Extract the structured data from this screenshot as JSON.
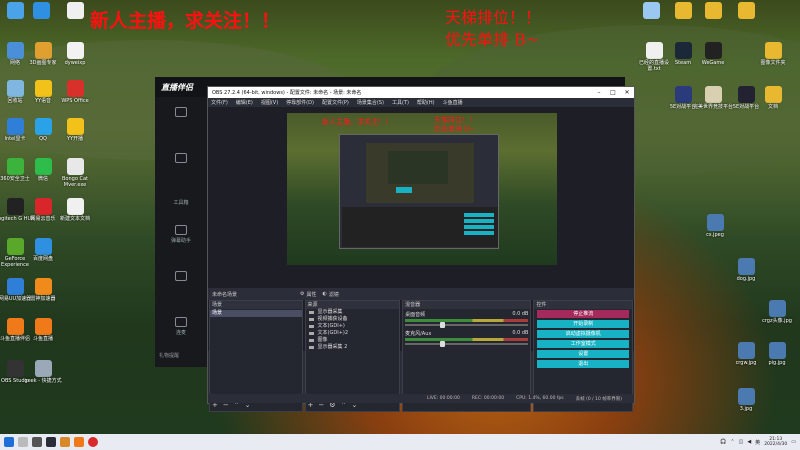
{
  "banners": {
    "line1": "新人主播，求关注！！",
    "line2": "天梯排位！！",
    "line3": "优先单排 B~"
  },
  "desktop_icons_left": [
    {
      "label": "",
      "color": "#4aa3e8"
    },
    {
      "label": "",
      "color": "#2f8fe0"
    },
    {
      "label": "",
      "color": "#f0f0f0"
    },
    {
      "label": "",
      "color": "#2f8fe0"
    },
    {
      "label": "网络",
      "color": "#4a8fd8"
    },
    {
      "label": "3D画图专家",
      "color": "#e0a030"
    },
    {
      "label": "dyweixp",
      "color": "#f2f2f2"
    },
    {
      "label": "回收站",
      "color": "#7fb7e0"
    },
    {
      "label": "YY语音",
      "color": "#f2c21a"
    },
    {
      "label": "WPS Office",
      "color": "#d8302a"
    },
    {
      "label": "Intel显卡",
      "color": "#2f7fd8"
    },
    {
      "label": "QQ",
      "color": "#2aa2e8"
    },
    {
      "label": "YY开播",
      "color": "#f2c21a"
    },
    {
      "label": "360安全卫士",
      "color": "#3cb33c"
    },
    {
      "label": "微信",
      "color": "#2ebd4a"
    },
    {
      "label": "Bongo Cat Mver.exe",
      "color": "#e8e8e8"
    },
    {
      "label": "Logitech G HUB",
      "color": "#222"
    },
    {
      "label": "网易云音乐",
      "color": "#d8262a"
    },
    {
      "label": "新建文本文档",
      "color": "#f0f0f0"
    },
    {
      "label": "GeForce Experience",
      "color": "#5aa82a"
    },
    {
      "label": "百度网盘",
      "color": "#2f8fe0"
    },
    {
      "label": "网易UU加速器",
      "color": "#2f7fd8"
    },
    {
      "label": "雷神加速器",
      "color": "#f08a1a"
    },
    {
      "label": "斗鱼直播伴侣",
      "color": "#f07a1a"
    },
    {
      "label": "斗鱼直播",
      "color": "#f07a1a"
    },
    {
      "label": "OBS Studio",
      "color": "#333"
    },
    {
      "label": "geek - 快捷方式",
      "color": "#9aa8b8"
    }
  ],
  "desktop_icons_right": [
    {
      "label": "",
      "color": "#9ac8f0"
    },
    {
      "label": "",
      "color": "#e8b830"
    },
    {
      "label": "",
      "color": "#e8b830"
    },
    {
      "label": "",
      "color": "#e8b830"
    },
    {
      "label": "已经的直播设置.txt",
      "color": "#f0f0f0"
    },
    {
      "label": "Steam",
      "color": "#1b2838"
    },
    {
      "label": "WeGame",
      "color": "#222"
    },
    {
      "label": "图像文件夹",
      "color": "#e8b830"
    },
    {
      "label": "5E对战平台",
      "color": "#2a3a7a"
    },
    {
      "label": "完美世界竞技平台",
      "color": "#d8d0b0"
    },
    {
      "label": "5E对战平台",
      "color": "#223"
    },
    {
      "label": "文档",
      "color": "#e8b830"
    },
    {
      "label": "cs.jpeg",
      "color": "#4a7ab0"
    },
    {
      "label": "dog.jpg",
      "color": "#4a7ab0"
    },
    {
      "label": "crgz头像.jpg",
      "color": "#4a7ab0"
    },
    {
      "label": "crgw.jpg",
      "color": "#4a7ab0"
    },
    {
      "label": "pig.jpg",
      "color": "#4a7ab0"
    },
    {
      "label": "3.jpg",
      "color": "#4a7ab0"
    }
  ],
  "assistant": {
    "title": "直播伴侣",
    "side_items": [
      "",
      "",
      "",
      "工具箱",
      "弹幕助手",
      "",
      "",
      "连麦",
      "更多"
    ],
    "bottom_text": "礼物提醒"
  },
  "obs": {
    "title": "OBS 27.2.4 (64-bit, windows) - 配置文件: 未命名 - 场景: 未命名",
    "menu": [
      "文件(F)",
      "编辑(E)",
      "视图(V)",
      "停靠部件(D)",
      "配置文件(P)",
      "场景集合(S)",
      "工具(T)",
      "帮助(H)",
      "斗鱼直播"
    ],
    "scene_bar": {
      "label": "未命名场景",
      "props": "属性",
      "filters": "滤镜"
    },
    "docks": {
      "scenes": {
        "title": "场景",
        "items": [
          "场景"
        ]
      },
      "sources": {
        "title": "来源",
        "items": [
          "显示器采集",
          "视频捕获设备",
          "文本(GDI+)",
          "文本(GDI+)2",
          "图像",
          "显示器采集 2"
        ]
      },
      "mixer": {
        "title": "混音器",
        "channels": [
          {
            "name": "桌面音频",
            "db": "0.0 dB"
          },
          {
            "name": "麦克风/Aux",
            "db": "0.0 dB"
          }
        ]
      },
      "controls": {
        "title": "控件",
        "buttons": [
          "停止推流",
          "开始录制",
          "启动虚拟摄像机",
          "工作室模式",
          "设置",
          "退出"
        ]
      }
    },
    "status": [
      "LIVE: 00:00:00",
      "REC: 00:00:00",
      "CPU: 1.4%, 60.00 fps",
      "丢帧 (0 / 10 帧率界限)"
    ]
  },
  "taskbar": {
    "time": "21:13",
    "date": "2022/4/30",
    "lang": "英"
  },
  "colors": {
    "banner": "#ff1010",
    "obs_cyan": "#17b3c4",
    "obs_stop": "#a32a5a"
  }
}
